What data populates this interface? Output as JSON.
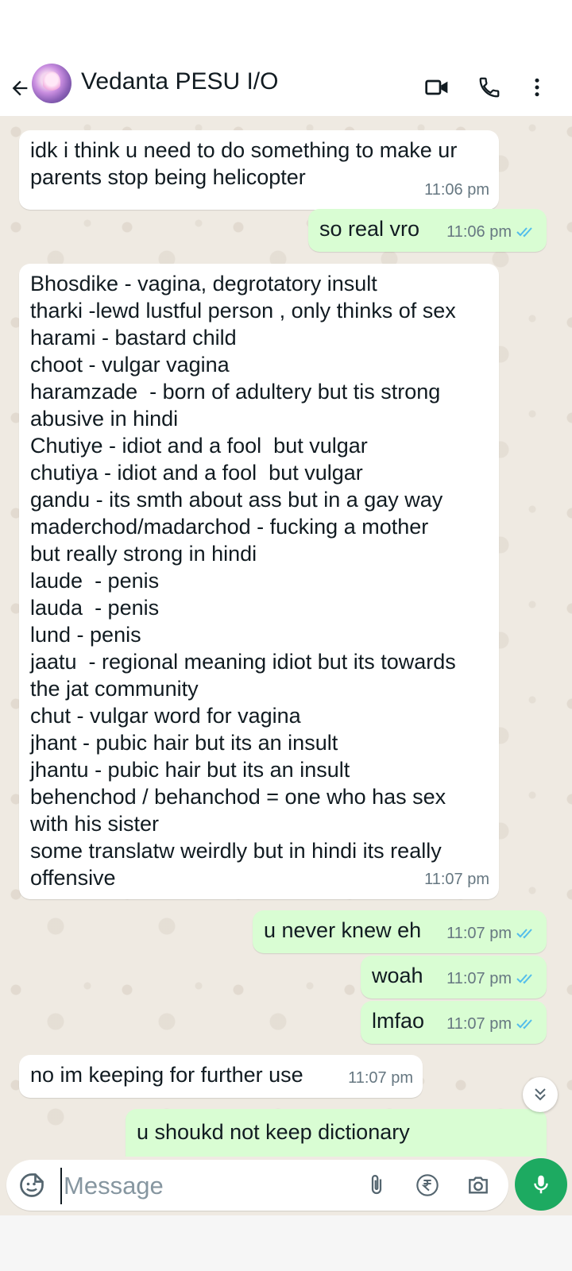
{
  "header": {
    "contact_name": "Vedanta PESU I/O",
    "icons": [
      "back-arrow-icon",
      "video-call-icon",
      "voice-call-icon",
      "more-options-icon"
    ]
  },
  "messages": [
    {
      "direction": "in",
      "text": "idk i think u need to do something to make ur\nparents stop being helicopter",
      "time": "11:06 pm"
    },
    {
      "direction": "out",
      "text": "so real vro",
      "time": "11:06 pm",
      "status": "read"
    },
    {
      "direction": "in",
      "text": "Bhosdike - vagina, degrotatory insult\ntharki -lewd lustful person , only thinks of sex\nharami - bastard child\nchoot - vulgar vagina\nharamzade  - born of adultery but tis strong\nabusive in hindi\nChutiye - idiot and a fool  but vulgar\nchutiya - idiot and a fool  but vulgar\ngandu - its smth about ass but in a gay way\nmaderchod/madarchod - fucking a mother\nbut really strong in hindi\nlaude  - penis\nlauda  - penis\nlund - penis\njaatu  - regional meaning idiot but its towards\nthe jat community\nchut - vulgar word for vagina\njhant - pubic hair but its an insult\njhantu - pubic hair but its an insult\nbehenchod / behanchod = one who has sex\nwith his sister\nsome translatw weirdly but in hindi its really\noffensive",
      "time": "11:07 pm"
    },
    {
      "direction": "out",
      "text": "u never knew eh",
      "time": "11:07 pm",
      "status": "read"
    },
    {
      "direction": "out",
      "text": "woah",
      "time": "11:07 pm",
      "status": "read"
    },
    {
      "direction": "out",
      "text": "lmfao",
      "time": "11:07 pm",
      "status": "read"
    },
    {
      "direction": "in",
      "text": "no im keeping for further use",
      "time": "11:07 pm"
    },
    {
      "direction": "out",
      "text": "u shoukd not keep dictionary",
      "time": "",
      "status": "partial"
    }
  ],
  "composer": {
    "placeholder": "Message",
    "icons": [
      "sticker-icon",
      "attach-icon",
      "payment-rupee-icon",
      "camera-icon",
      "microphone-icon"
    ]
  },
  "colors": {
    "incoming_bubble": "#ffffff",
    "outgoing_bubble": "#d9fdd3",
    "chat_background": "#efeae2",
    "read_ticks": "#53bdeb",
    "mic_button": "#1daa61"
  }
}
